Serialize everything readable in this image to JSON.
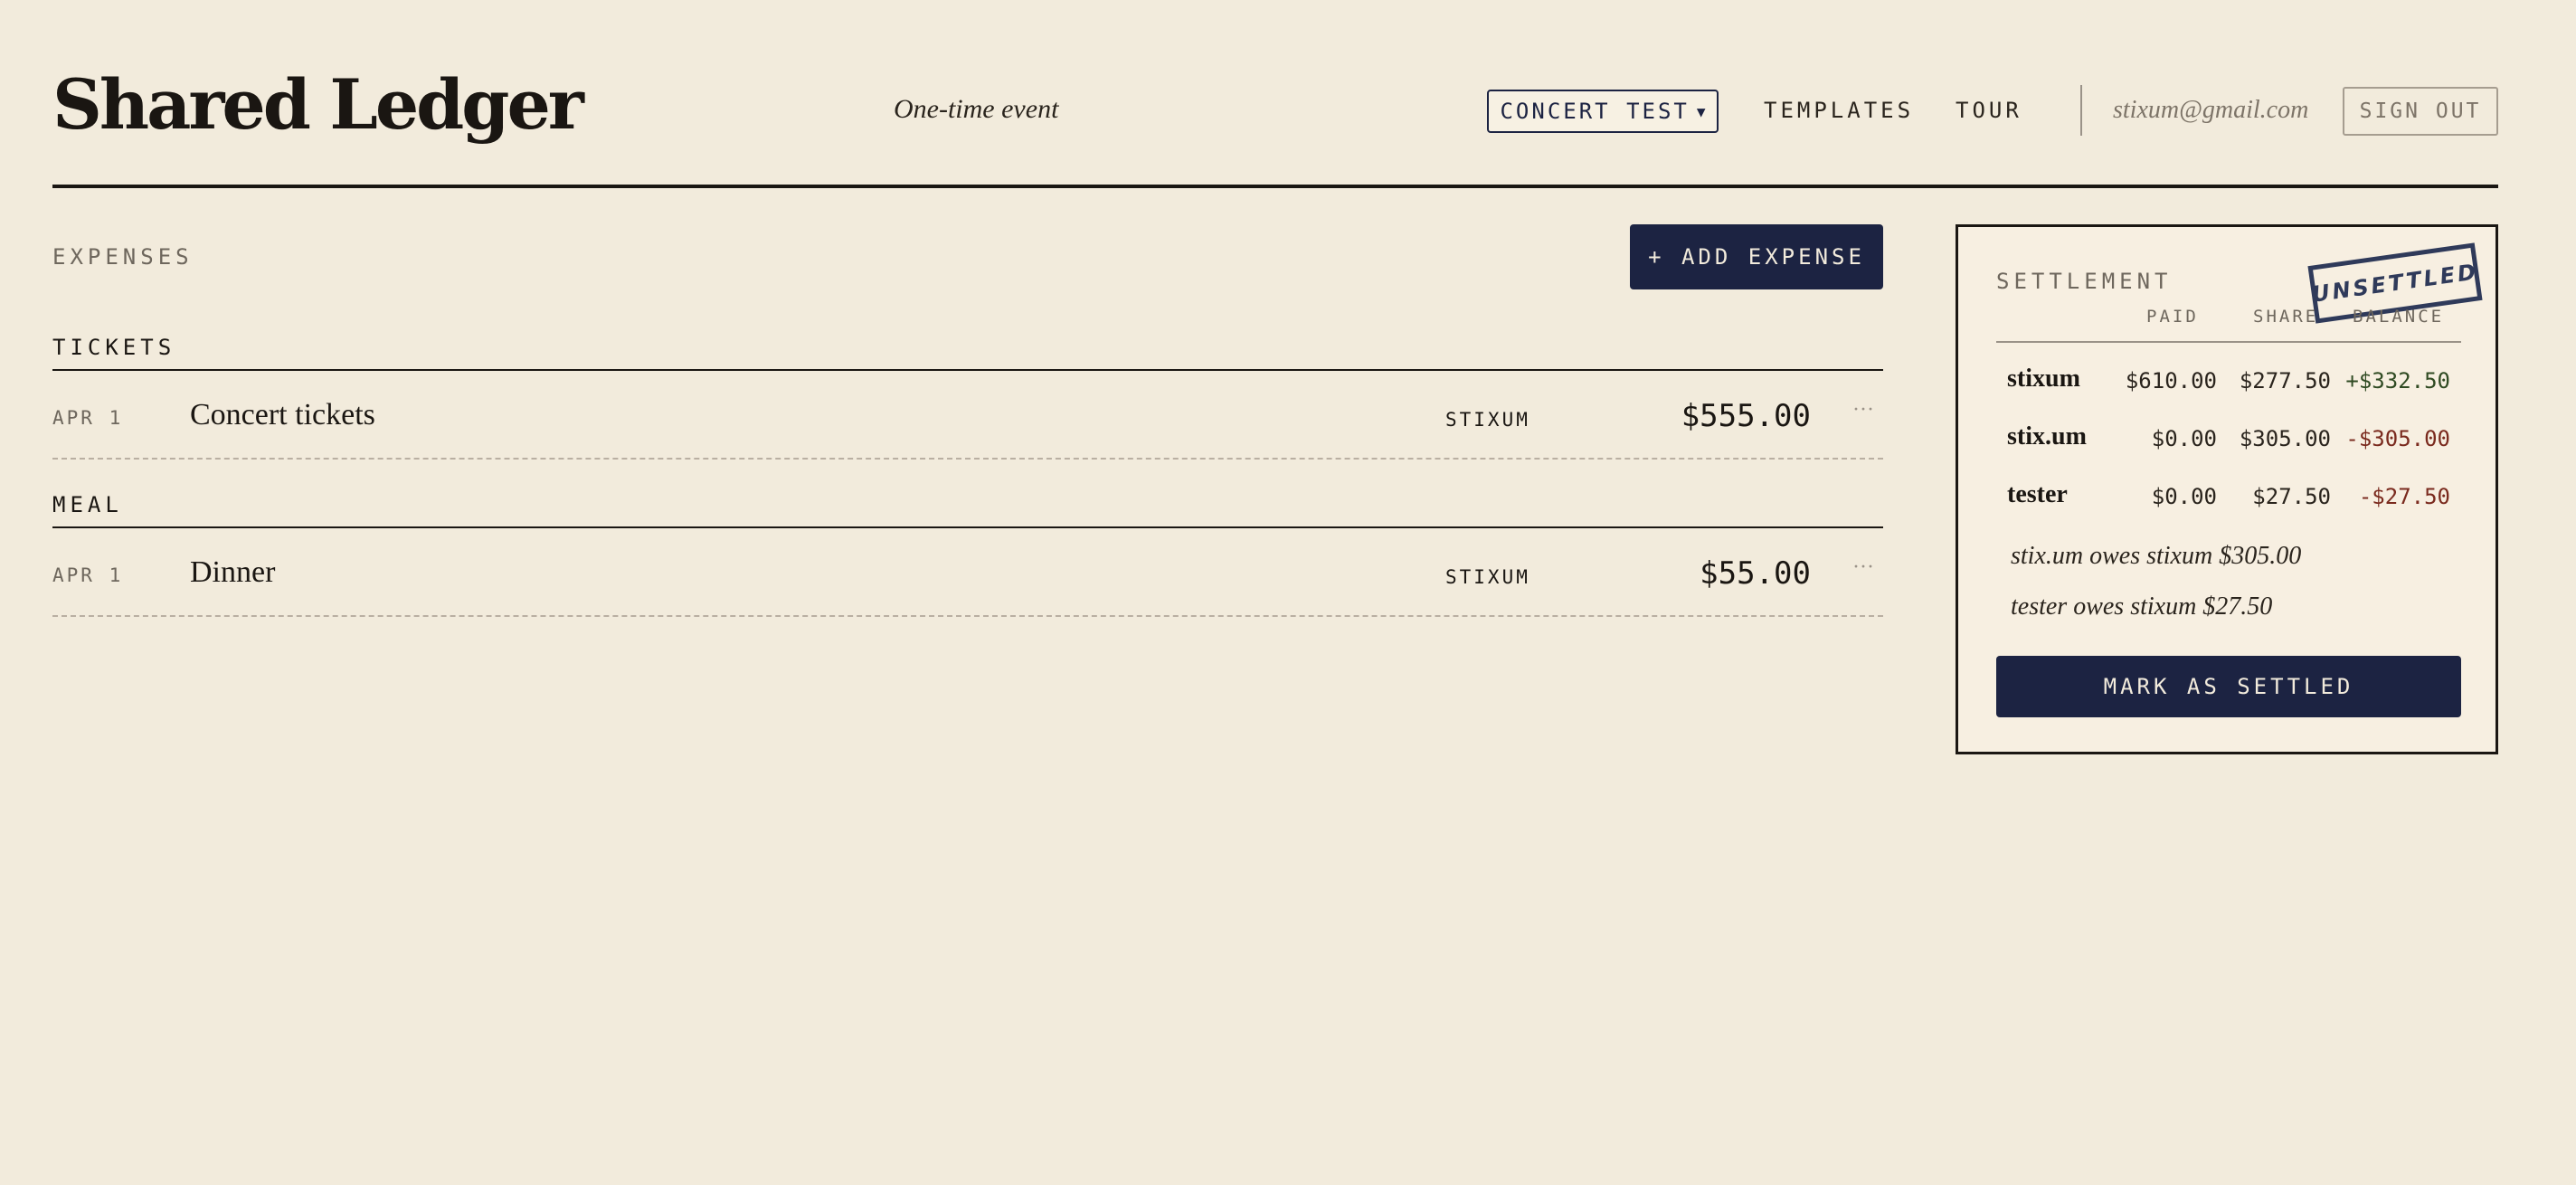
{
  "header": {
    "logo": "Shared Ledger",
    "subtitle": "One-time event",
    "event_select": "CONCERT TEST",
    "nav": {
      "templates": "TEMPLATES",
      "tour": "TOUR"
    },
    "user_email": "stixum@gmail.com",
    "sign_out": "SIGN OUT"
  },
  "expenses": {
    "label": "EXPENSES",
    "add_button": "+ ADD EXPENSE",
    "groups": [
      {
        "title": "TICKETS",
        "rows": [
          {
            "date": "APR 1",
            "description": "Concert tickets",
            "payer": "STIXUM",
            "amount": "$555.00"
          }
        ]
      },
      {
        "title": "MEAL",
        "rows": [
          {
            "date": "APR 1",
            "description": "Dinner",
            "payer": "STIXUM",
            "amount": "$55.00"
          }
        ]
      }
    ]
  },
  "settlement": {
    "label": "SETTLEMENT",
    "stamp": "UNSETTLED",
    "columns": {
      "paid": "PAID",
      "share": "SHARE",
      "balance": "BALANCE"
    },
    "people": [
      {
        "name": "stixum",
        "paid": "$610.00",
        "share": "$277.50",
        "balance": "+$332.50"
      },
      {
        "name": "stix.um",
        "paid": "$0.00",
        "share": "$305.00",
        "balance": "-$305.00"
      },
      {
        "name": "tester",
        "paid": "$0.00",
        "share": "$27.50",
        "balance": "-$27.50"
      }
    ],
    "owes": [
      "stix.um owes stixum $305.00",
      "tester owes stixum $27.50"
    ],
    "settle_button": "MARK AS SETTLED"
  },
  "colors": {
    "background": "#f2ebdc",
    "accent": "#1c2342",
    "positive": "#2f4a22",
    "negative": "#7a2a1e"
  }
}
